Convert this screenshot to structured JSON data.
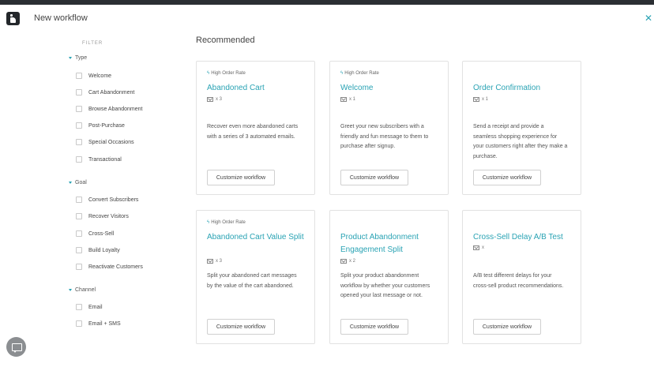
{
  "header": {
    "title": "New workflow",
    "close_icon": "close-icon"
  },
  "sidebar": {
    "filters_label": "Filter",
    "groups": [
      {
        "label": "Type",
        "options": [
          "Welcome",
          "Cart Abandonment",
          "Browse Abandonment",
          "Post-Purchase",
          "Special Occasions",
          "Transactional"
        ]
      },
      {
        "label": "Goal",
        "options": [
          "Convert Subscribers",
          "Recover Visitors",
          "Cross-Sell",
          "Build Loyalty",
          "Reactivate Customers"
        ]
      },
      {
        "label": "Channel",
        "options": [
          "Email",
          "Email + SMS"
        ]
      }
    ]
  },
  "main": {
    "section_title": "Recommended",
    "cards": [
      {
        "badge": "High Order Rate",
        "title": "Abandoned Cart",
        "meta": "x 3",
        "description": "Recover even more abandoned carts with a series of 3 automated emails.",
        "button": "Customize workflow"
      },
      {
        "badge": "High Order Rate",
        "title": "Welcome",
        "meta": "x 1",
        "description": "Greet your new subscribers with a friendly and fun message to them to purchase after signup.",
        "button": "Customize workflow"
      },
      {
        "badge": "",
        "title": "Order Confirmation",
        "meta": "x 1",
        "description": "Send a receipt and provide a seamless shopping experience for your customers right after they make a purchase.",
        "button": "Customize workflow"
      },
      {
        "badge": "High Order Rate",
        "title": "Abandoned Cart Value Split",
        "meta": "x 3",
        "description": "Split your abandoned cart messages by the value of the cart abandoned.",
        "button": "Customize workflow"
      },
      {
        "badge": "",
        "title": "Product Abandonment Engagement Split",
        "meta": "x 2",
        "description": "Split your product abandonment workflow by whether your customers opened your last message or not.",
        "button": "Customize workflow"
      },
      {
        "badge": "",
        "title": "Cross-Sell Delay A/B Test",
        "meta": "x",
        "description": "A/B test different delays for your cross-sell product recommendations.",
        "button": "Customize workflow"
      }
    ]
  },
  "colors": {
    "accent": "#2aa3b4",
    "topbar": "#2b2f33"
  },
  "icons": {
    "chat": "chat-icon",
    "mail": "mail-icon",
    "bolt": "bolt-icon"
  }
}
